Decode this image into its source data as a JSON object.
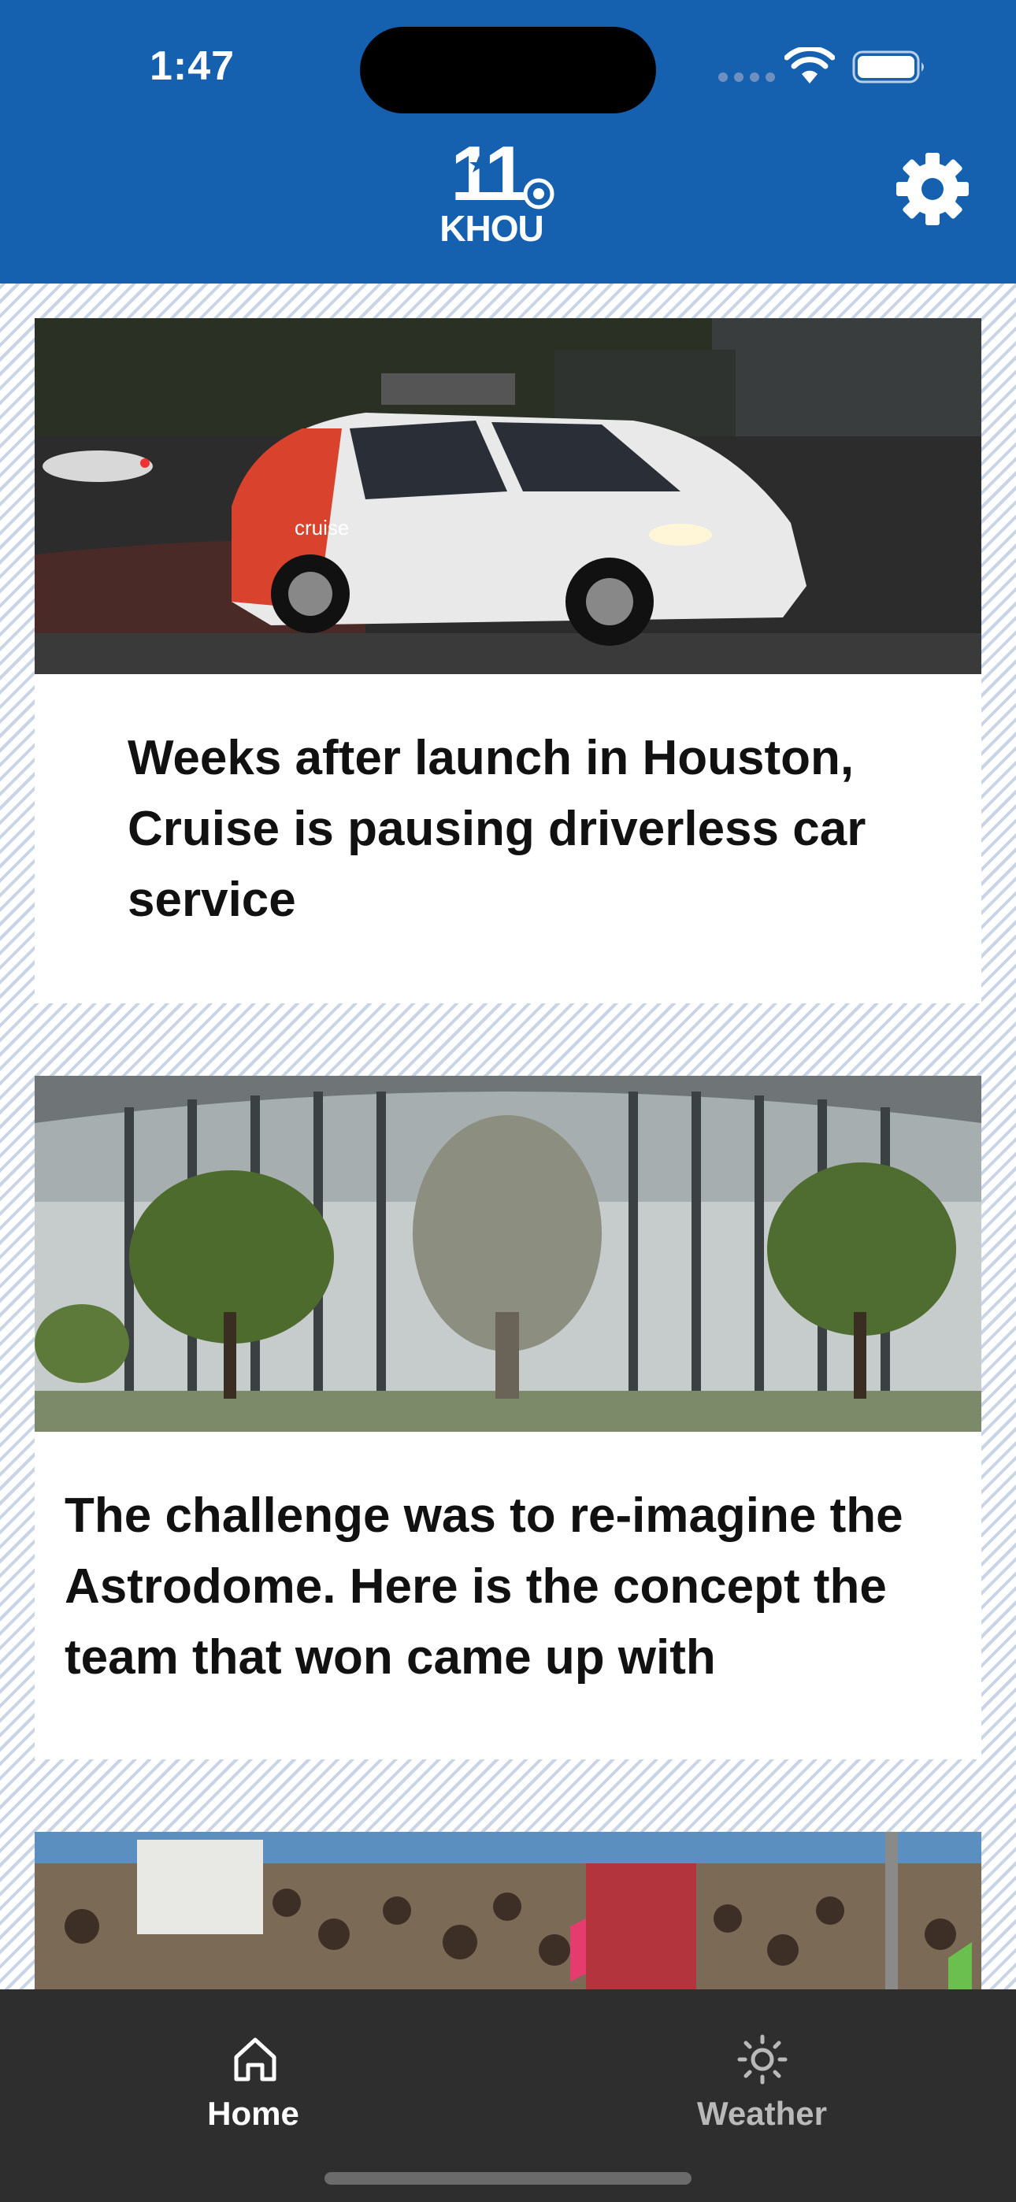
{
  "status_bar": {
    "time": "1:47"
  },
  "header": {
    "logo_number": "11",
    "logo_text": "KHOU",
    "settings_icon": "gear-icon",
    "background_color": "#1660b0"
  },
  "feed": {
    "articles": [
      {
        "title": "Weeks after launch in Houston, Cruise is pausing driverless car service",
        "image_text": "cruise"
      },
      {
        "title": "The challenge was to re-imagine the Astrodome. Here is the concept the team that won came up with"
      },
      {
        "title": ""
      }
    ]
  },
  "tab_bar": {
    "tabs": [
      {
        "label": "Home",
        "icon": "home-icon",
        "selected": true
      },
      {
        "label": "Weather",
        "icon": "sun-icon",
        "selected": false
      }
    ],
    "active_color": "#ffffff",
    "inactive_color": "#b9b9b9",
    "background_color": "#2e2e2e"
  }
}
